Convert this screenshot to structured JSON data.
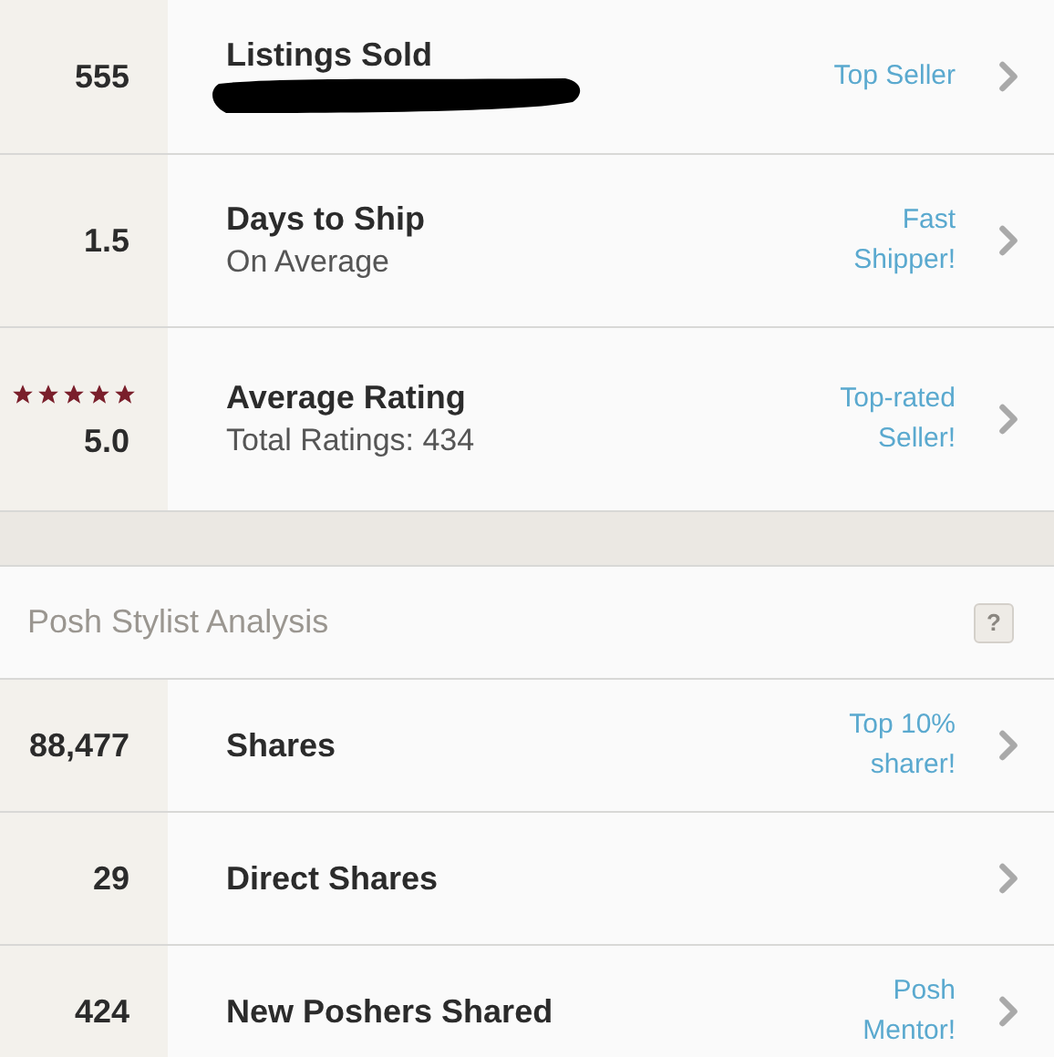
{
  "seller_stats": [
    {
      "value": "555",
      "title": "Listings Sold",
      "redacted": true,
      "badge_lines": [
        "Top Seller"
      ]
    },
    {
      "value": "1.5",
      "title": "Days to Ship",
      "subtitle": "On Average",
      "redacted": false,
      "badge_lines": [
        "Fast",
        "Shipper!"
      ]
    },
    {
      "value": "5.0",
      "stars": 5,
      "title": "Average Rating",
      "subtitle": "Total Ratings: 434",
      "redacted": false,
      "badge_lines": [
        "Top-rated",
        "Seller!"
      ]
    }
  ],
  "stylist_section": {
    "title": "Posh Stylist Analysis",
    "help_button": "?"
  },
  "stylist_stats": [
    {
      "value": "88,477",
      "title": "Shares",
      "redacted": false,
      "badge_lines": [
        "Top 10%",
        "sharer!"
      ]
    },
    {
      "value": "29",
      "title": "Direct Shares",
      "redacted": false
    },
    {
      "value": "424",
      "title": "New Poshers Shared",
      "redacted": false,
      "badge_lines": [
        "Posh",
        "Mentor!"
      ]
    }
  ]
}
